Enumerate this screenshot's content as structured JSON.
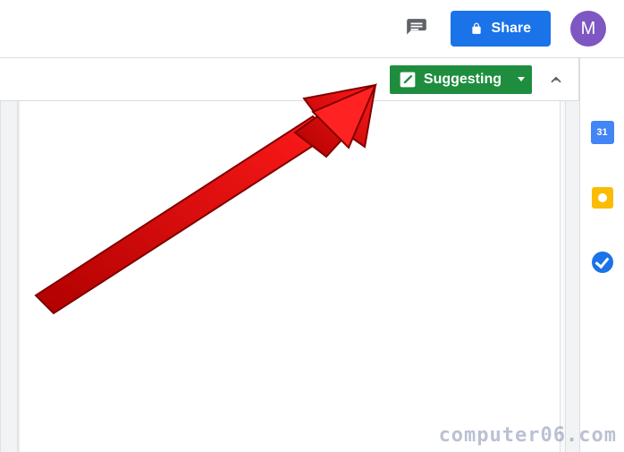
{
  "header": {
    "share_label": "Share",
    "avatar_initial": "M"
  },
  "toolbar": {
    "mode_label": "Suggesting"
  },
  "side_panel": {
    "calendar_day": "31"
  },
  "watermark": "computer06.com"
}
